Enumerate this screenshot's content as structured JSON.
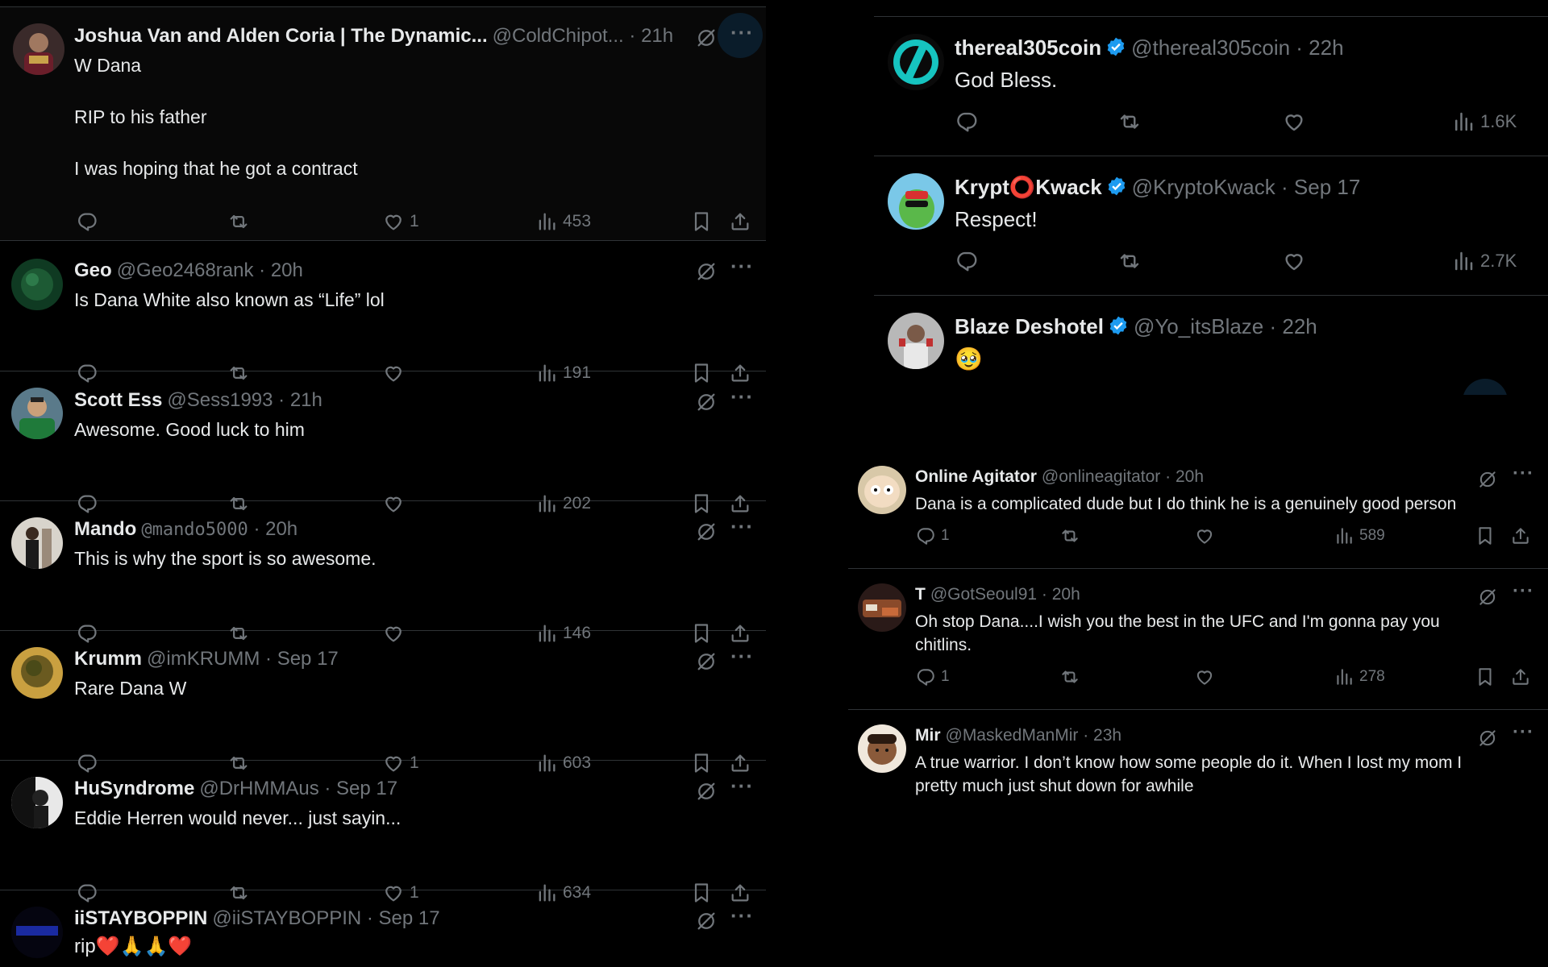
{
  "left_column": {
    "tweets": [
      {
        "name": "Joshua Van and Alden Coria | The Dynamic...",
        "handle": "@ColdChipot...",
        "time": "· 21h",
        "text": [
          "W Dana",
          "RIP to his father",
          "I was hoping that he got a contract"
        ],
        "likes": "1",
        "views": "453"
      },
      {
        "name": "Geo",
        "handle": "@Geo2468rank",
        "time": "· 20h",
        "text": [
          "Is Dana White also known as “Life” lol"
        ],
        "likes": "",
        "views": "191"
      },
      {
        "name": "Scott Ess",
        "handle": "@Sess1993",
        "time": "· 21h",
        "text": [
          "Awesome. Good luck to him"
        ],
        "likes": "",
        "views": "202"
      },
      {
        "name": "Mando",
        "handle": "@mando5000",
        "time": "· 20h",
        "text": [
          "This is why the sport is so awesome."
        ],
        "likes": "",
        "views": "146"
      },
      {
        "name": "Krumm",
        "handle": "@imKRUMM",
        "time": "· Sep 17",
        "text": [
          "Rare Dana W"
        ],
        "likes": "1",
        "views": "603"
      },
      {
        "name": "HuSyndrome",
        "handle": "@DrHMMAus",
        "time": "· Sep 17",
        "text": [
          "Eddie Herren would never... just sayin..."
        ],
        "likes": "1",
        "views": "634"
      },
      {
        "name": "iiSTAYBOPPIN",
        "handle": "@iiSTAYBOPPIN",
        "time": "· Sep 17",
        "text": [
          "rip❤️🙏🙏❤️"
        ],
        "likes": "",
        "views": ""
      }
    ]
  },
  "right_top": {
    "tweets": [
      {
        "name": "thereal305coin",
        "handle": "@thereal305coin",
        "time": "· 22h",
        "text": "God Bless.",
        "views": "1.6K"
      },
      {
        "name": "Krypt⭕Kwack",
        "handle": "@KryptoKwack",
        "time": "· Sep 17",
        "text": "Respect!",
        "views": "2.7K"
      },
      {
        "name": "Blaze Deshotel",
        "handle": "@Yo_itsBlaze",
        "time": "· 22h",
        "text": "🥹",
        "views": ""
      }
    ]
  },
  "right_bottom": {
    "tweets": [
      {
        "name": "Online Agitator",
        "handle": "@onlineagitator",
        "time": "· 20h",
        "text": [
          "Dana is a complicated dude but I do think he is a genuinely good person"
        ],
        "replies": "1",
        "views": "589"
      },
      {
        "name": "T",
        "handle": "@GotSeoul91",
        "time": "· 20h",
        "text": [
          "Oh stop Dana....I wish you the best in the UFC and I'm gonna pay you",
          "chitlins."
        ],
        "replies": "1",
        "views": "278"
      },
      {
        "name": "Mir",
        "handle": "@MaskedManMir",
        "time": "· 23h",
        "text": [
          "A true warrior. I don’t know how some people do it. When I lost my mom I",
          "pretty much just shut down for awhile"
        ],
        "replies": "",
        "views": ""
      }
    ]
  },
  "colors": {
    "background": "#000000",
    "text": "#e7e9ea",
    "muted": "#71767b",
    "divider": "#2f3336",
    "verified": "#1d9bf0"
  },
  "icons": [
    "reply-icon",
    "retweet-icon",
    "like-icon",
    "views-icon",
    "bookmark-icon",
    "share-icon",
    "grok-icon",
    "more-icon",
    "verified-icon"
  ]
}
